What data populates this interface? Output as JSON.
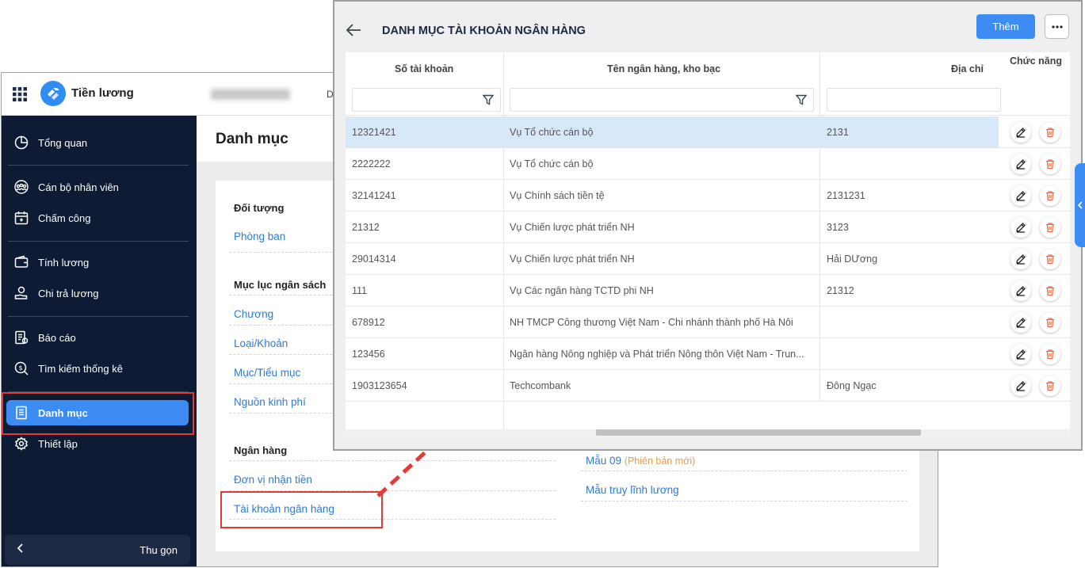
{
  "app": {
    "title": "Tiền lương",
    "topbar_letter": "D"
  },
  "sidebar": {
    "items": [
      {
        "label": "Tổng quan",
        "icon": "pie-chart-icon"
      },
      {
        "label": "Cán bộ nhân viên",
        "icon": "people-icon"
      },
      {
        "label": "Chấm công",
        "icon": "calendar-icon"
      },
      {
        "label": "Tính lương",
        "icon": "wallet-icon"
      },
      {
        "label": "Chi trả lương",
        "icon": "hand-coin-icon"
      },
      {
        "label": "Báo cáo",
        "icon": "report-icon"
      },
      {
        "label": "Tìm kiếm thống kê",
        "icon": "search-dollar-icon"
      },
      {
        "label": "Danh mục",
        "icon": "document-icon"
      },
      {
        "label": "Thiết lập",
        "icon": "gear-icon"
      }
    ],
    "collapse_label": "Thu gọn"
  },
  "main": {
    "title": "Danh mục",
    "sections": {
      "doi_tuong": {
        "heading": "Đối tượng",
        "links": [
          "Phòng ban"
        ]
      },
      "muc_luc": {
        "heading": "Mục lục ngân sách",
        "links": [
          "Chương",
          "Loại/Khoản",
          "Mục/Tiểu mục",
          "Nguồn kinh phí"
        ]
      },
      "ngan_hang": {
        "heading": "Ngân hàng",
        "links": [
          "Đơn vị nhận tiền",
          "Tài khoản ngân hàng"
        ]
      },
      "mau": {
        "links": [
          "Mẫu 09",
          "Mẫu truy lĩnh lương"
        ],
        "new_version_label": "(Phiên bản mới)"
      }
    }
  },
  "dialog": {
    "title": "DANH MỤC TÀI KHOẢN NGÂN HÀNG",
    "add_label": "Thêm",
    "columns": [
      "Số tài khoản",
      "Tên ngân hàng, kho bạc",
      "Địa chỉ",
      "Chức năng"
    ],
    "rows": [
      {
        "account": "12321421",
        "bank": "Vụ Tổ chức cán bộ",
        "address": "2131"
      },
      {
        "account": "2222222",
        "bank": "Vụ Tổ chức cán bộ",
        "address": ""
      },
      {
        "account": "32141241",
        "bank": "Vụ Chính sách tiền tệ",
        "address": "2131231"
      },
      {
        "account": "21312",
        "bank": "Vụ Chiến lược phát triển NH",
        "address": "3123"
      },
      {
        "account": "29014314",
        "bank": "Vụ Chiến lược phát triển NH",
        "address": "Hải DƯơng"
      },
      {
        "account": "111",
        "bank": "Vụ Các ngân hàng  TCTD phi NH",
        "address": "21312"
      },
      {
        "account": "678912",
        "bank": "NH TMCP Công thương Việt Nam - Chi nhánh thành phố Hà Nôi",
        "address": ""
      },
      {
        "account": "123456",
        "bank": "Ngân hàng Nông nghiệp và Phát triển Nông thôn Việt Nam - Trun...",
        "address": ""
      },
      {
        "account": "1903123654",
        "bank": "Techcombank",
        "address": "Đông Ngạc"
      }
    ]
  },
  "colors": {
    "sidebar_bg": "#0d1b34",
    "accent": "#3d8cf4",
    "link": "#2f7ad8",
    "highlight": "#e53935",
    "delete_icon": "#ef6c4a"
  }
}
